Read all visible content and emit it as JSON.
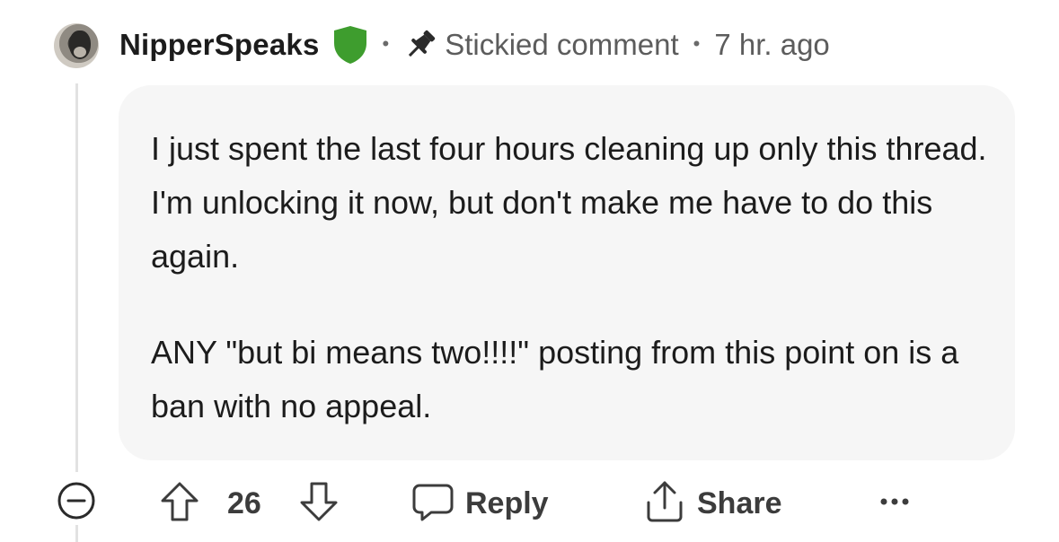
{
  "comment": {
    "author": "NipperSpeaks",
    "sticky_label": "Stickied comment",
    "separator": "•",
    "timestamp": "7 hr. ago",
    "paragraphs": [
      "I just spent the last four hours cleaning up only this thread. I'm unlocking it now, but don't make me have to do this again.",
      "ANY \"but bi means two!!!!\" posting from this point on is a ban with no appeal."
    ]
  },
  "actions": {
    "score": "26",
    "reply_label": "Reply",
    "share_label": "Share"
  },
  "icons": {
    "avatar": "dog-avatar",
    "mod": "shield-icon",
    "sticky": "pin-icon",
    "collapse": "minus-circle-icon",
    "upvote": "arrow-up-icon",
    "downvote": "arrow-down-icon",
    "reply": "speech-bubble-icon",
    "share": "share-icon",
    "more": "ellipsis-icon"
  },
  "colors": {
    "mod_shield": "#3e9d2e",
    "bubble_bg": "#f6f6f6",
    "text": "#1c1c1c",
    "meta": "#5c5c5c"
  }
}
